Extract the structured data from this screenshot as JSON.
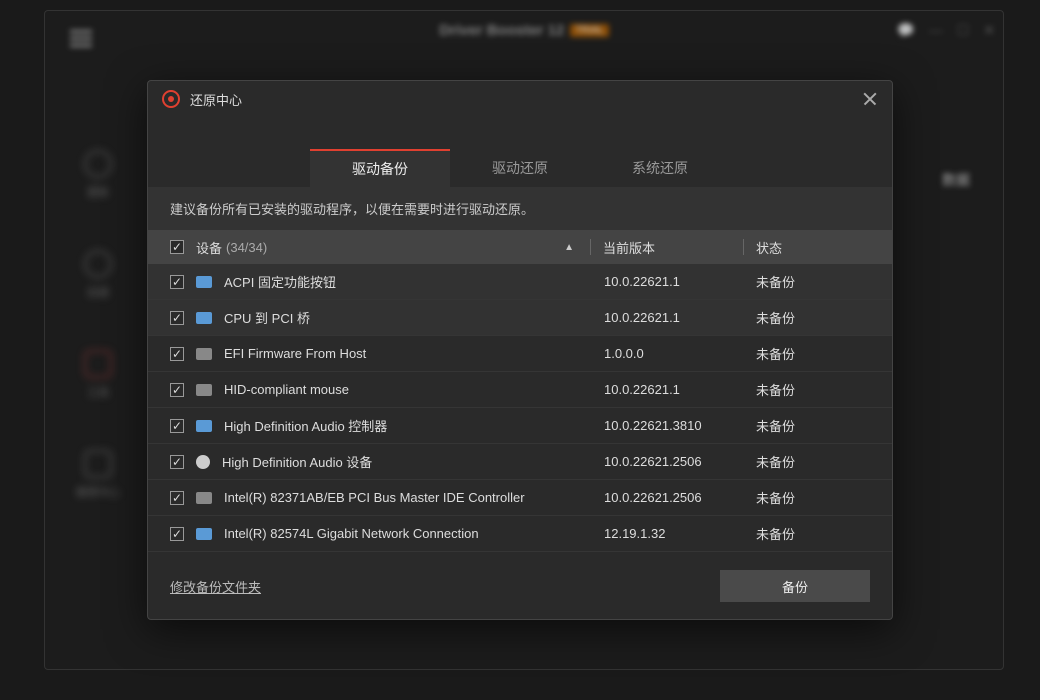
{
  "app": {
    "title": "Driver Booster 12",
    "trial_badge": "TRIAL"
  },
  "sidebar": {
    "items": [
      {
        "label": "更新"
      },
      {
        "label": "加速"
      },
      {
        "label": "工具"
      },
      {
        "label": "推荐中心"
      }
    ]
  },
  "right_hint": "数据",
  "dialog": {
    "title": "还原中心",
    "tabs": [
      {
        "label": "驱动备份",
        "active": true
      },
      {
        "label": "驱动还原",
        "active": false
      },
      {
        "label": "系统还原",
        "active": false
      }
    ],
    "hint": "建议备份所有已安装的驱动程序，以便在需要时进行驱动还原。",
    "columns": {
      "device": "设备",
      "count": "(34/34)",
      "version": "当前版本",
      "status": "状态"
    },
    "rows": [
      {
        "name": "ACPI 固定功能按钮",
        "version": "10.0.22621.1",
        "status": "未备份",
        "hl": true,
        "icon": "blue"
      },
      {
        "name": "CPU 到 PCI 桥",
        "version": "10.0.22621.1",
        "status": "未备份",
        "hl": true,
        "icon": "blue"
      },
      {
        "name": "EFI Firmware From Host",
        "version": "1.0.0.0",
        "status": "未备份",
        "hl": false,
        "icon": "grey"
      },
      {
        "name": "HID-compliant mouse",
        "version": "10.0.22621.1",
        "status": "未备份",
        "hl": false,
        "icon": "grey"
      },
      {
        "name": "High Definition Audio 控制器",
        "version": "10.0.22621.3810",
        "status": "未备份",
        "hl": false,
        "icon": "blue"
      },
      {
        "name": "High Definition Audio 设备",
        "version": "10.0.22621.2506",
        "status": "未备份",
        "hl": false,
        "icon": "round"
      },
      {
        "name": "Intel(R) 82371AB/EB PCI Bus Master IDE Controller",
        "version": "10.0.22621.2506",
        "status": "未备份",
        "hl": false,
        "icon": "grey"
      },
      {
        "name": "Intel(R) 82574L Gigabit Network Connection",
        "version": "12.19.1.32",
        "status": "未备份",
        "hl": false,
        "icon": "blue"
      }
    ],
    "footer": {
      "folder_link": "修改备份文件夹",
      "backup_btn": "备份"
    }
  }
}
